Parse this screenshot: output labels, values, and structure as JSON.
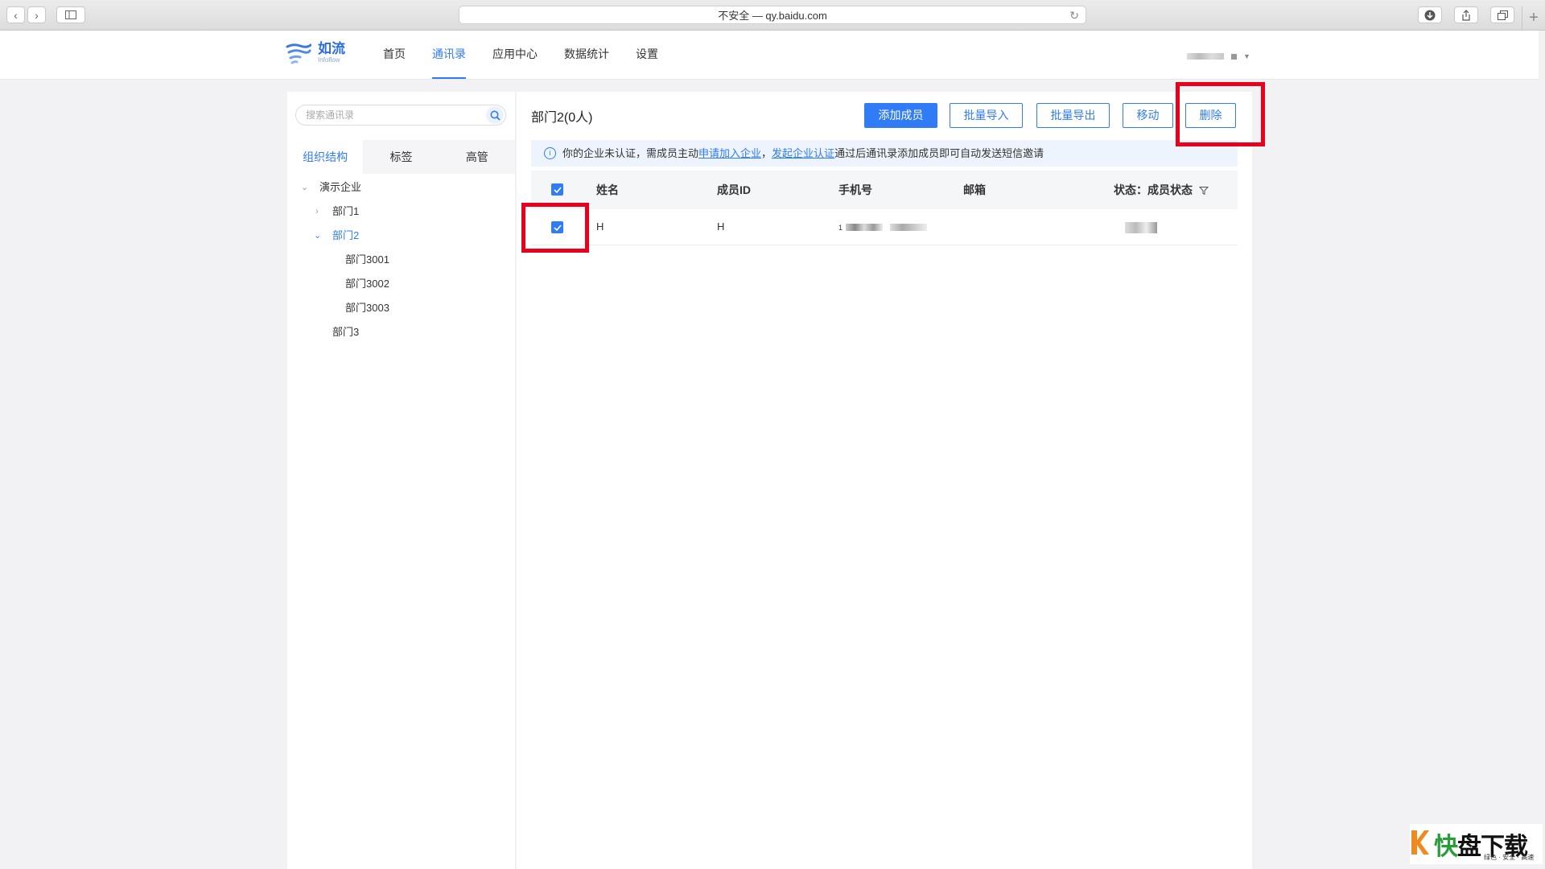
{
  "browser": {
    "address": "不安全 — qy.baidu.com"
  },
  "app": {
    "logo_name": "如流",
    "logo_sub": "Infoflow",
    "nav": [
      {
        "label": "首页",
        "active": false
      },
      {
        "label": "通讯录",
        "active": true
      },
      {
        "label": "应用中心",
        "active": false
      },
      {
        "label": "数据统计",
        "active": false
      },
      {
        "label": "设置",
        "active": false
      }
    ]
  },
  "sidebar": {
    "search_placeholder": "搜索通讯录",
    "tabs": [
      "组织结构",
      "标签",
      "高管"
    ],
    "tree": [
      {
        "label": "演示企业",
        "level": 0,
        "arrow": "down",
        "active": false
      },
      {
        "label": "部门1",
        "level": 1,
        "arrow": "right",
        "active": false
      },
      {
        "label": "部门2",
        "level": 1,
        "arrow": "down",
        "active": true
      },
      {
        "label": "部门3001",
        "level": 2,
        "arrow": "",
        "active": false
      },
      {
        "label": "部门3002",
        "level": 2,
        "arrow": "",
        "active": false
      },
      {
        "label": "部门3003",
        "level": 2,
        "arrow": "",
        "active": false
      },
      {
        "label": "部门3",
        "level": 1,
        "arrow": "",
        "active": false
      }
    ]
  },
  "main": {
    "dept_title": "部门2(0人)",
    "buttons": {
      "add": "添加成员",
      "import": "批量导入",
      "export": "批量导出",
      "move": "移动",
      "delete": "删除"
    },
    "notice": {
      "prefix": "你的企业未认证，需成员主动",
      "link1": "申请加入企业",
      "sep": "，",
      "link2": "发起企业认证",
      "suffix": "通过后通讯录添加成员即可自动发送短信邀请"
    },
    "table": {
      "headers": [
        "姓名",
        "成员ID",
        "手机号",
        "邮箱",
        "状态：成员状态"
      ],
      "rows": [
        {
          "name": "H",
          "id": "H",
          "phone_prefix": "1",
          "email": "",
          "checked": true
        }
      ]
    }
  },
  "watermark": {
    "big_a": "快",
    "big_b": "盘下载",
    "small": "绿色 · 安全 · 高速"
  },
  "colors": {
    "accent": "#2f7cf6",
    "highlight": "#e8001c"
  }
}
